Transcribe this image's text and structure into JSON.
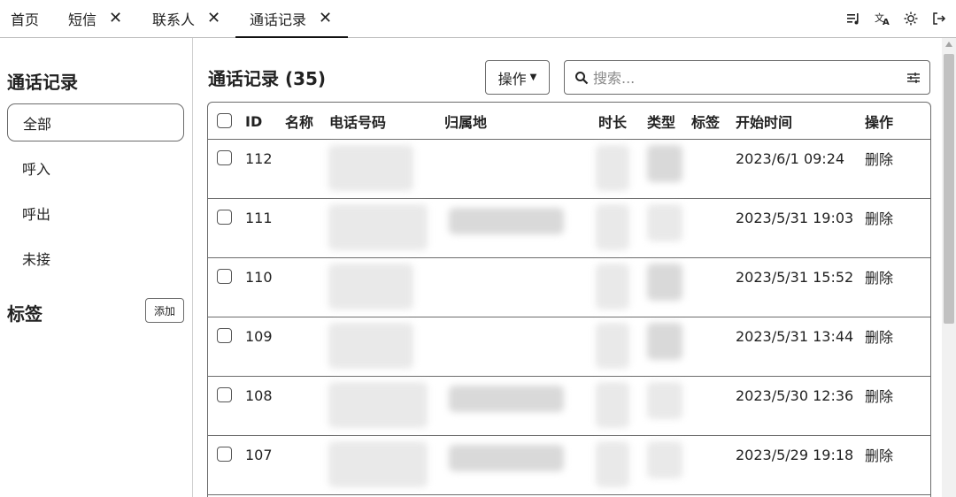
{
  "tabs": [
    {
      "label": "首页",
      "closable": false
    },
    {
      "label": "短信",
      "closable": true
    },
    {
      "label": "联系人",
      "closable": true
    },
    {
      "label": "通话记录",
      "closable": true,
      "active": true
    }
  ],
  "close_glyph": "✕",
  "top_icons": [
    "playlist-icon",
    "translate-icon",
    "theme-sun-icon",
    "logout-icon"
  ],
  "sidebar": {
    "title": "通话记录",
    "items": [
      {
        "label": "全部",
        "active": true
      },
      {
        "label": "呼入"
      },
      {
        "label": "呼出"
      },
      {
        "label": "未接"
      }
    ],
    "tags_title": "标签",
    "add_label": "添加"
  },
  "main": {
    "title": "通话记录 (35)",
    "ops_label": "操作",
    "search_placeholder": "搜索..."
  },
  "table": {
    "columns": [
      "ID",
      "名称",
      "电话号码",
      "归属地",
      "时长",
      "类型",
      "标签",
      "开始时间",
      "操作"
    ],
    "rows": [
      {
        "id": "112",
        "start": "2023/6/1 09:24",
        "action": "删除"
      },
      {
        "id": "111",
        "start": "2023/5/31 19:03",
        "action": "删除"
      },
      {
        "id": "110",
        "start": "2023/5/31 15:52",
        "action": "删除"
      },
      {
        "id": "109",
        "start": "2023/5/31 13:44",
        "action": "删除"
      },
      {
        "id": "108",
        "start": "2023/5/30 12:36",
        "action": "删除"
      },
      {
        "id": "107",
        "start": "2023/5/29 19:18",
        "action": "删除"
      }
    ]
  }
}
